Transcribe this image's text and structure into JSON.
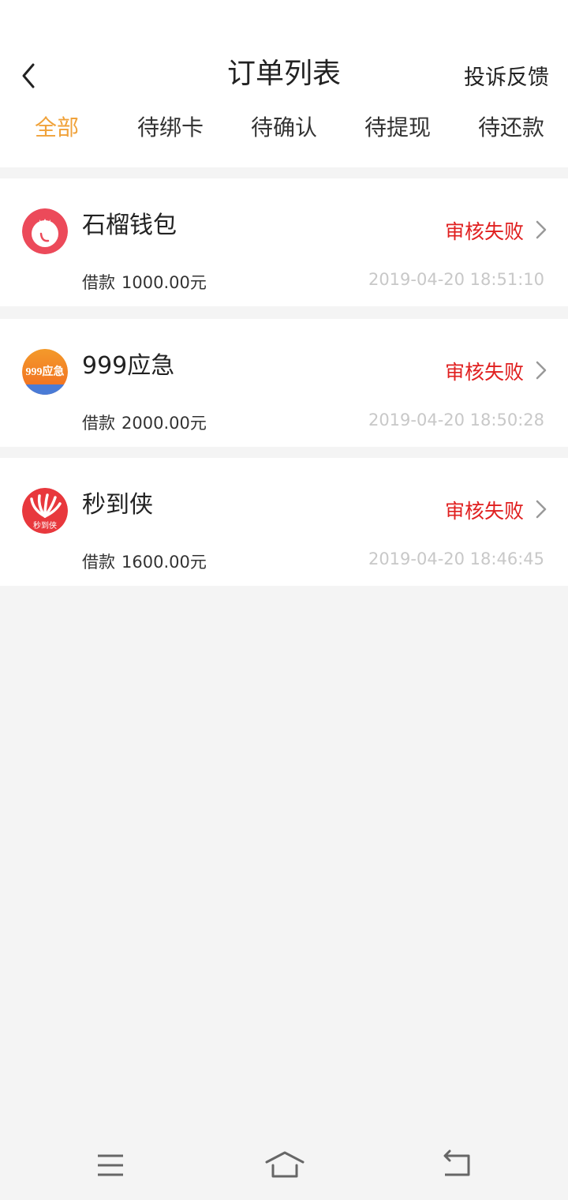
{
  "header": {
    "title": "订单列表",
    "right_action": "投诉反馈",
    "back_icon": "chevron-left-icon"
  },
  "tabs": [
    {
      "label": "全部",
      "active": true
    },
    {
      "label": "待绑卡",
      "active": false
    },
    {
      "label": "待确认",
      "active": false
    },
    {
      "label": "待提现",
      "active": false
    },
    {
      "label": "待还款",
      "active": false
    }
  ],
  "colors": {
    "active_tab": "#f0a23a",
    "status_failed": "#e02020",
    "timestamp": "#c8c8c8",
    "background": "#f4f4f4"
  },
  "orders": [
    {
      "name": "石榴钱包",
      "logo": "pomegranate-logo",
      "status": "审核失败",
      "amount_prefix": "借款",
      "amount": "1000.00元",
      "time": "2019-04-20 18:51:10"
    },
    {
      "name": "999应急",
      "logo": "999-emergency-logo",
      "logo_text": "999应急",
      "status": "审核失败",
      "amount_prefix": "借款",
      "amount": "2000.00元",
      "time": "2019-04-20 18:50:28"
    },
    {
      "name": "秒到侠",
      "logo": "miaodaoxia-logo",
      "logo_text": "秒到侠",
      "status": "审核失败",
      "amount_prefix": "借款",
      "amount": "1600.00元",
      "time": "2019-04-20 18:46:45"
    }
  ],
  "system_nav": [
    "menu-icon",
    "home-icon",
    "back-icon"
  ]
}
